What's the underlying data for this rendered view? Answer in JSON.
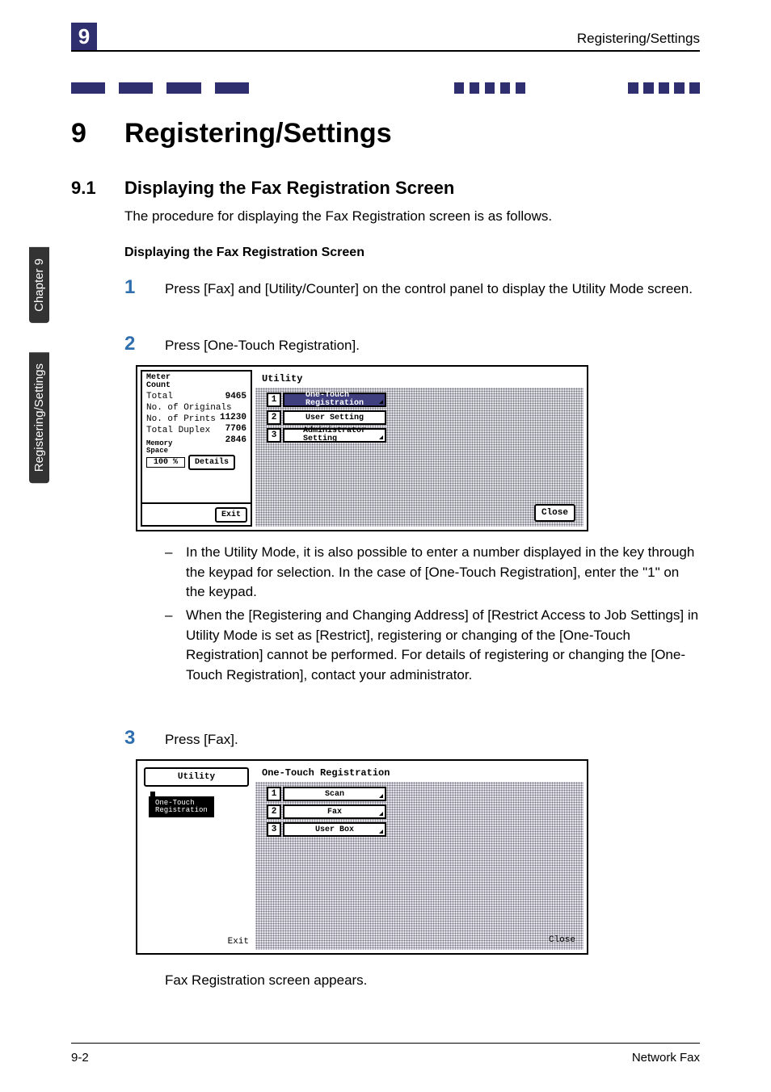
{
  "header": {
    "chapter_badge": "9",
    "running_title": "Registering/Settings"
  },
  "sidetabs": {
    "tab1": "Chapter 9",
    "tab2": "Registering/Settings"
  },
  "chapter": {
    "number": "9",
    "title": "Registering/Settings"
  },
  "section": {
    "number": "9.1",
    "title": "Displaying the Fax Registration Screen",
    "intro": "The procedure for displaying the Fax Registration screen is as follows.",
    "subheading": "Displaying the Fax Registration Screen"
  },
  "steps": {
    "s1": {
      "num": "1",
      "text": "Press [Fax] and [Utility/Counter] on the control panel to display the Utility Mode screen."
    },
    "s2": {
      "num": "2",
      "text": "Press [One-Touch Registration]."
    },
    "s3": {
      "num": "3",
      "text": "Press [Fax]."
    }
  },
  "notes": {
    "n1": "In the Utility Mode, it is also possible to enter a number displayed in the key through the keypad for selection. In the case of [One-Touch Registration], enter the \"1\" on the keypad.",
    "n2": "When the [Registering and Changing Address] of [Restrict Access to Job Settings] in Utility Mode is set as [Restrict], registering or changing of the [One-Touch Registration] cannot be performed. For details of registering or changing the [One-Touch Registration], contact your administrator."
  },
  "closing": "Fax Registration screen appears.",
  "footer": {
    "left": "9-2",
    "right": "Network Fax"
  },
  "lcd1": {
    "meter_label": "Meter\nCount",
    "total_label": "Total",
    "total_value": "9465",
    "orig_label": "No. of Originals",
    "orig_value": "11230",
    "prints_label": "No. of Prints",
    "prints_value": "7706",
    "duplex_label": "Total Duplex",
    "duplex_value": "2846",
    "mem_label": "Memory\nSpace",
    "mem_value": "100 %",
    "details_btn": "Details",
    "exit_btn": "Exit",
    "right_title": "Utility",
    "menu": {
      "i1": {
        "num": "1",
        "label": "One-Touch\nRegistration"
      },
      "i2": {
        "num": "2",
        "label": "User Setting"
      },
      "i3": {
        "num": "3",
        "label": "Administrator\nSetting"
      }
    },
    "close_btn": "Close"
  },
  "lcd2": {
    "util_btn": "Utility",
    "crumb": "One-Touch\nRegistration",
    "right_title": "One-Touch Registration",
    "menu": {
      "i1": {
        "num": "1",
        "label": "Scan"
      },
      "i2": {
        "num": "2",
        "label": "Fax"
      },
      "i3": {
        "num": "3",
        "label": "User Box"
      }
    },
    "exit_btn": "Exit",
    "close_btn": "Close"
  }
}
